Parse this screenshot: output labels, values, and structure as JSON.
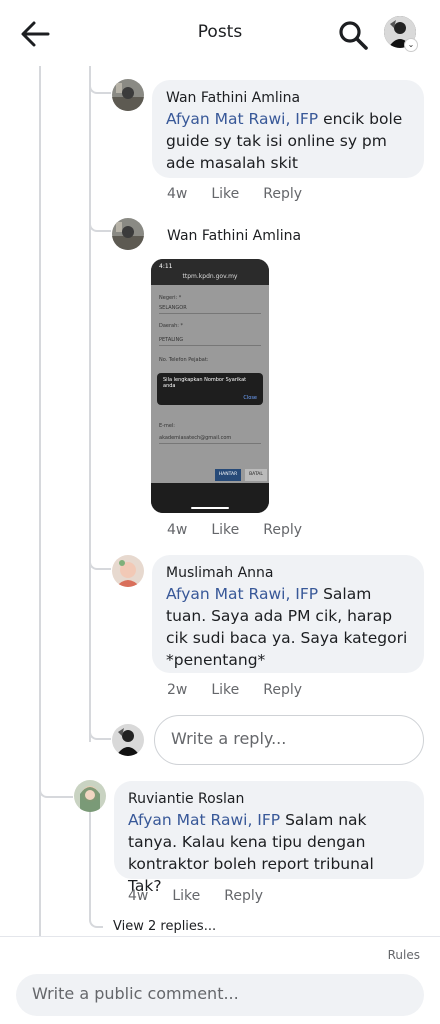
{
  "header": {
    "title": "Posts",
    "back_icon": "arrow-left-icon",
    "search_icon": "search-icon"
  },
  "comments": [
    {
      "author": "Wan Fathini Amlina",
      "mention": "Afyan Mat Rawi, IFP",
      "text": " encik bole guide sy tak isi online sy pm ade masalah skit",
      "time": "4w",
      "like": "Like",
      "reply": "Reply"
    },
    {
      "author": "Wan Fathini Amlina",
      "time": "4w",
      "like": "Like",
      "reply": "Reply",
      "screenshot": {
        "status_time": "4:11",
        "url": "ttpm.kpdn.gov.my",
        "field1_label": "Negeri: *",
        "field1_value": "SELANGOR",
        "field2_label": "Daerah: *",
        "field2_value": "PETALING",
        "field3_label": "No. Telefon Pejabat:",
        "dialog_text": "Sila lengkapkan Nombor Syarikat anda",
        "dialog_close": "Close",
        "field4_label": "E-mel:",
        "field4_value": "akademiasatech@gmail.com",
        "btn_primary": "HANTAR",
        "btn_secondary": "BATAL"
      }
    },
    {
      "author": "Muslimah Anna",
      "mention": "Afyan Mat Rawi, IFP",
      "text": " Salam tuan. Saya ada PM cik, harap cik sudi baca ya. Saya kategori *penentang*",
      "time": "2w",
      "like": "Like",
      "reply": "Reply"
    },
    {
      "author": "Ruviantie Roslan",
      "mention": "Afyan Mat Rawi, IFP",
      "text": " Salam nak tanya. Kalau kena tipu dengan kontraktor boleh report tribunal Tak?",
      "time": "4w",
      "like": "Like",
      "reply": "Reply"
    }
  ],
  "reply_box": {
    "placeholder": "Write a reply..."
  },
  "view_replies": "View 2 replies...",
  "footer": {
    "rules": "Rules",
    "placeholder": "Write a public comment..."
  }
}
